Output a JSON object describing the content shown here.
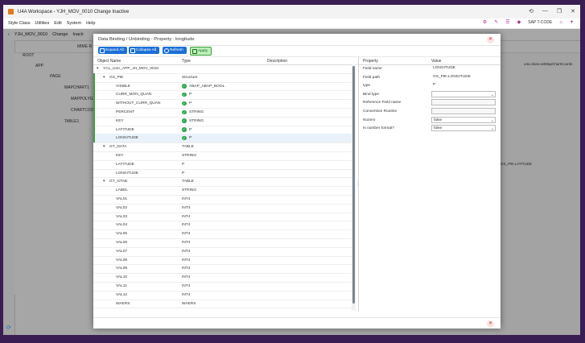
{
  "window": {
    "title": "U4A Workspace - YJH_MOV_0010 Change Inactive",
    "controls": [
      "⟲",
      "—",
      "❐",
      "✕"
    ]
  },
  "menu": {
    "items": [
      "Style Class",
      "Utilities",
      "Edit",
      "System",
      "Help"
    ],
    "tcode_label": "SAP T-CODE"
  },
  "background": {
    "app_name": "YJH_MOV_0010",
    "mode": "Change",
    "mode_tail": "Inacti",
    "mime_label": "MIME R",
    "tree": [
      "ROOT",
      "APP",
      "PAGE",
      "MAPCHART1",
      "MAPPOLYGON1",
      "CHARTCOOR",
      "TABLE1"
    ],
    "right_text": "u4a.class.setMapChartCoords",
    "right_field": "GS_PIE-LATITUDE"
  },
  "dialog": {
    "title": "Data Binding / Unbinding - Property : longitude",
    "toolbar": {
      "expand_all": "Expand All",
      "collapse_all": "Collapse All",
      "refresh": "Refresh",
      "apply": "Apply"
    },
    "columns": {
      "object_name": "Object Name",
      "type": "Type",
      "description": "Description"
    },
    "rows": [
      {
        "name": "YCL_U4A_APP_JH_MOV_0010",
        "type": "",
        "indent": 0,
        "expand": "▾",
        "check": false,
        "mark": false
      },
      {
        "name": "GS_PIE",
        "type": "Structure",
        "indent": 1,
        "expand": "▾",
        "check": false,
        "mark": true
      },
      {
        "name": "VISIBLE",
        "type": "ABAP_ABAP_BOOL",
        "indent": 2,
        "expand": "",
        "check": true,
        "mark": true
      },
      {
        "name": "CURR_MON_QUAN",
        "type": "P",
        "indent": 2,
        "expand": "",
        "check": true,
        "mark": true
      },
      {
        "name": "WITHOUT_CURR_QUAN",
        "type": "P",
        "indent": 2,
        "expand": "",
        "check": true,
        "mark": true
      },
      {
        "name": "PERCENT",
        "type": "STRING",
        "indent": 2,
        "expand": "",
        "check": true,
        "mark": true
      },
      {
        "name": "KEY",
        "type": "STRING",
        "indent": 2,
        "expand": "",
        "check": true,
        "mark": true
      },
      {
        "name": "LATITUDE",
        "type": "P",
        "indent": 2,
        "expand": "",
        "check": true,
        "mark": true
      },
      {
        "name": "LONGITUDE",
        "type": "P",
        "indent": 2,
        "expand": "",
        "check": true,
        "mark": true,
        "selected": true
      },
      {
        "name": "GT_DATA",
        "type": "TABLE",
        "indent": 1,
        "expand": "▾",
        "check": false,
        "mark": false
      },
      {
        "name": "KEY",
        "type": "STRING",
        "indent": 2,
        "expand": "",
        "check": false,
        "mark": false
      },
      {
        "name": "LATITUDE",
        "type": "P",
        "indent": 2,
        "expand": "",
        "check": false,
        "mark": false
      },
      {
        "name": "LONGITUDE",
        "type": "P",
        "indent": 2,
        "expand": "",
        "check": false,
        "mark": false
      },
      {
        "name": "GT_GTAB",
        "type": "TABLE",
        "indent": 1,
        "expand": "▾",
        "check": false,
        "mark": false
      },
      {
        "name": "LABEL",
        "type": "STRING",
        "indent": 2,
        "expand": "",
        "check": false,
        "mark": false
      },
      {
        "name": "VAL01",
        "type": "INT4",
        "indent": 2,
        "expand": "",
        "check": false,
        "mark": false
      },
      {
        "name": "VAL02",
        "type": "INT4",
        "indent": 2,
        "expand": "",
        "check": false,
        "mark": false
      },
      {
        "name": "VAL03",
        "type": "INT4",
        "indent": 2,
        "expand": "",
        "check": false,
        "mark": false
      },
      {
        "name": "VAL04",
        "type": "INT4",
        "indent": 2,
        "expand": "",
        "check": false,
        "mark": false
      },
      {
        "name": "VAL05",
        "type": "INT4",
        "indent": 2,
        "expand": "",
        "check": false,
        "mark": false
      },
      {
        "name": "VAL06",
        "type": "INT4",
        "indent": 2,
        "expand": "",
        "check": false,
        "mark": false
      },
      {
        "name": "VAL07",
        "type": "INT4",
        "indent": 2,
        "expand": "",
        "check": false,
        "mark": false
      },
      {
        "name": "VAL08",
        "type": "INT4",
        "indent": 2,
        "expand": "",
        "check": false,
        "mark": false
      },
      {
        "name": "VAL09",
        "type": "INT4",
        "indent": 2,
        "expand": "",
        "check": false,
        "mark": false
      },
      {
        "name": "VAL10",
        "type": "INT4",
        "indent": 2,
        "expand": "",
        "check": false,
        "mark": false
      },
      {
        "name": "VAL11",
        "type": "INT4",
        "indent": 2,
        "expand": "",
        "check": false,
        "mark": false
      },
      {
        "name": "VAL12",
        "type": "INT4",
        "indent": 2,
        "expand": "",
        "check": false,
        "mark": false
      },
      {
        "name": "WAERS",
        "type": "WAERS",
        "indent": 2,
        "expand": "",
        "check": false,
        "mark": false
      }
    ],
    "properties": {
      "columns": {
        "property": "Property",
        "value": "Value"
      },
      "items": [
        {
          "label": "Field name",
          "value": "LONGITUDE",
          "style": "plain"
        },
        {
          "label": "Field path",
          "value": "GS_PIE-LONGITUDE",
          "style": "plain"
        },
        {
          "label": "type",
          "value": "P",
          "style": "plain"
        },
        {
          "label": "Bind type",
          "value": "",
          "style": "select"
        },
        {
          "label": "Reference Field name",
          "value": "",
          "style": "input"
        },
        {
          "label": "Conversion Routine",
          "value": "",
          "style": "input"
        },
        {
          "label": "Nozero",
          "value": "false",
          "style": "select"
        },
        {
          "label": "Is number format?",
          "value": "false",
          "style": "select"
        }
      ]
    }
  },
  "colors": {
    "frame_bg": "#3a1d52",
    "primary": "#1b6fd6",
    "success": "#2fa84f",
    "close": "#c83333"
  }
}
